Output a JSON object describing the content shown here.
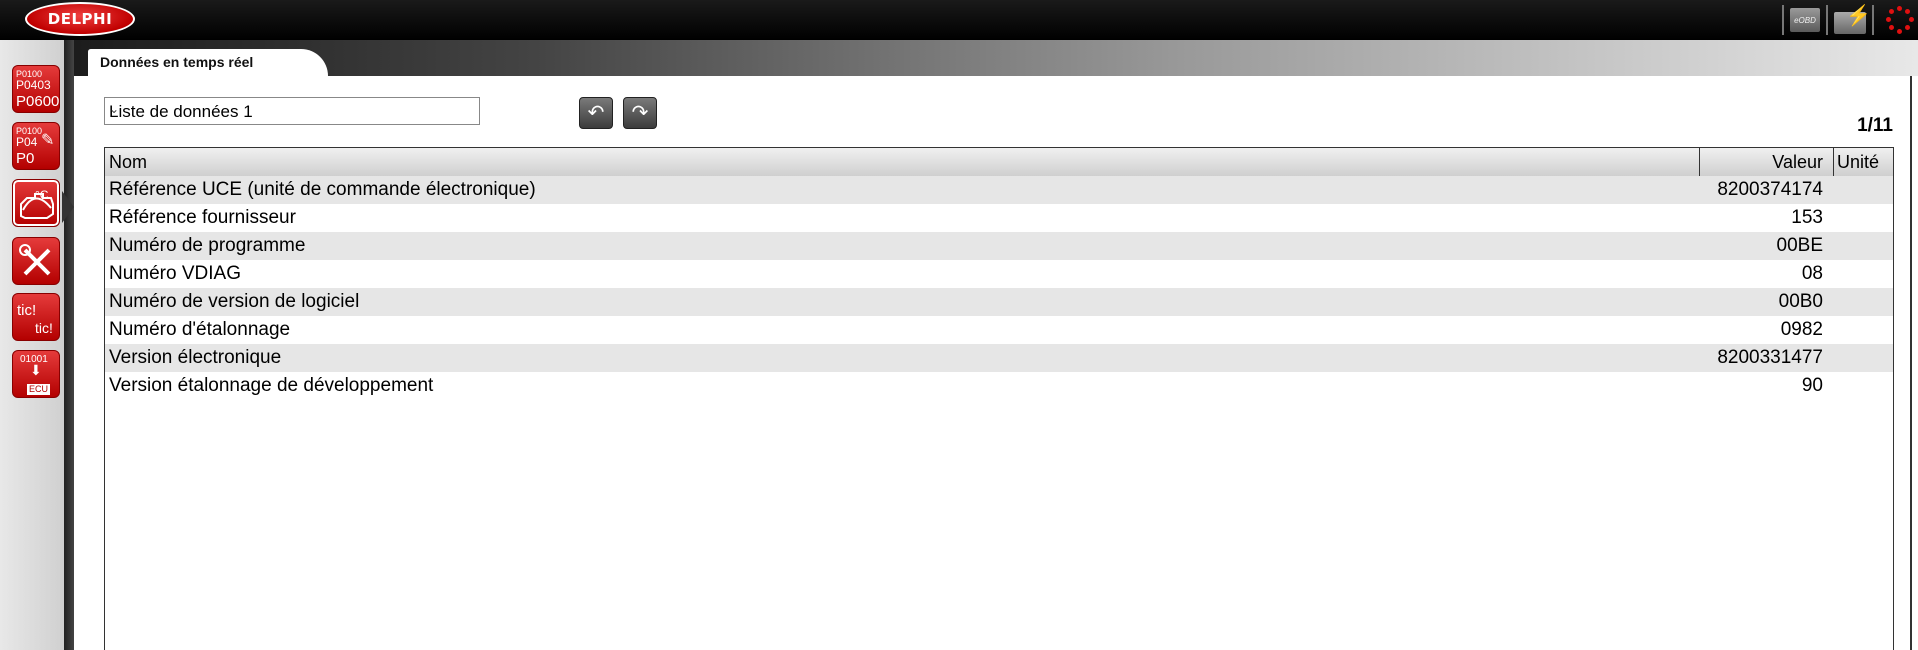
{
  "app": {
    "logo_text": "DELPHI",
    "eobd_label": "eOBD"
  },
  "sidebar": {
    "buttons": [
      {
        "name": "read-dtc",
        "lines": [
          "P0100",
          "P0403",
          "P0600"
        ]
      },
      {
        "name": "clear-dtc",
        "lines": [
          "P0100",
          "P04",
          "P0"
        ]
      },
      {
        "name": "live-data",
        "lines": [
          "",
          "°C",
          ""
        ]
      },
      {
        "name": "service-tools",
        "lines": [
          ""
        ]
      },
      {
        "name": "actuator-test",
        "lines": [
          "tic!",
          "tic!"
        ]
      },
      {
        "name": "ecu-programming",
        "lines": [
          "01001",
          "ECU"
        ]
      }
    ]
  },
  "tab": {
    "label": "Données en temps réel"
  },
  "controls": {
    "list_select": "Liste de données 1",
    "page_indicator": "1/11"
  },
  "table": {
    "headers": {
      "name": "Nom",
      "value": "Valeur",
      "unit": "Unité"
    },
    "rows": [
      {
        "name": "Référence UCE (unité de commande électronique)",
        "value": "8200374174",
        "unit": ""
      },
      {
        "name": "Référence fournisseur",
        "value": "153",
        "unit": ""
      },
      {
        "name": "Numéro de programme",
        "value": "00BE",
        "unit": ""
      },
      {
        "name": "Numéro VDIAG",
        "value": "08",
        "unit": ""
      },
      {
        "name": "Numéro de version de logiciel",
        "value": "00B0",
        "unit": ""
      },
      {
        "name": "Numéro d'étalonnage",
        "value": "0982",
        "unit": ""
      },
      {
        "name": "Version électronique",
        "value": "8200331477",
        "unit": ""
      },
      {
        "name": "Version étalonnage de développement",
        "value": "90",
        "unit": ""
      }
    ]
  },
  "colors": {
    "brand_red": "#d01010",
    "row_alt": "#e6e6e6"
  }
}
